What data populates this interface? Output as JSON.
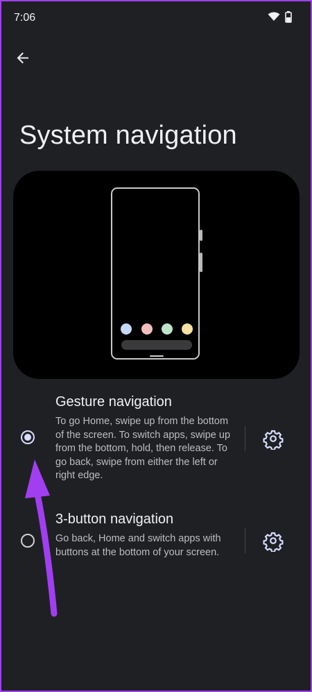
{
  "status_bar": {
    "time": "7:06",
    "icons": [
      "wifi-icon",
      "battery-icon"
    ]
  },
  "header": {
    "back_icon": "back-arrow-icon",
    "title": "System navigation"
  },
  "illustration": {
    "description_icon": "phone-illustration",
    "dot_colors": [
      "#c5d8f6",
      "#f3bfbd",
      "#bfe5c8",
      "#f6e2a0"
    ]
  },
  "options": [
    {
      "title": "Gesture navigation",
      "description": "To go Home, swipe up from the bottom of the screen. To switch apps, swipe up from the bottom, hold, then release. To go back, swipe from either the left or right edge.",
      "selected": true,
      "settings_icon": "gear-icon"
    },
    {
      "title": "3-button navigation",
      "description": "Go back, Home and switch apps with buttons at the bottom of your screen.",
      "selected": false,
      "settings_icon": "gear-icon"
    }
  ],
  "colors": {
    "background": "#1f2023",
    "accent": "#d8dcff",
    "annotation_arrow": "#a13ff0"
  }
}
